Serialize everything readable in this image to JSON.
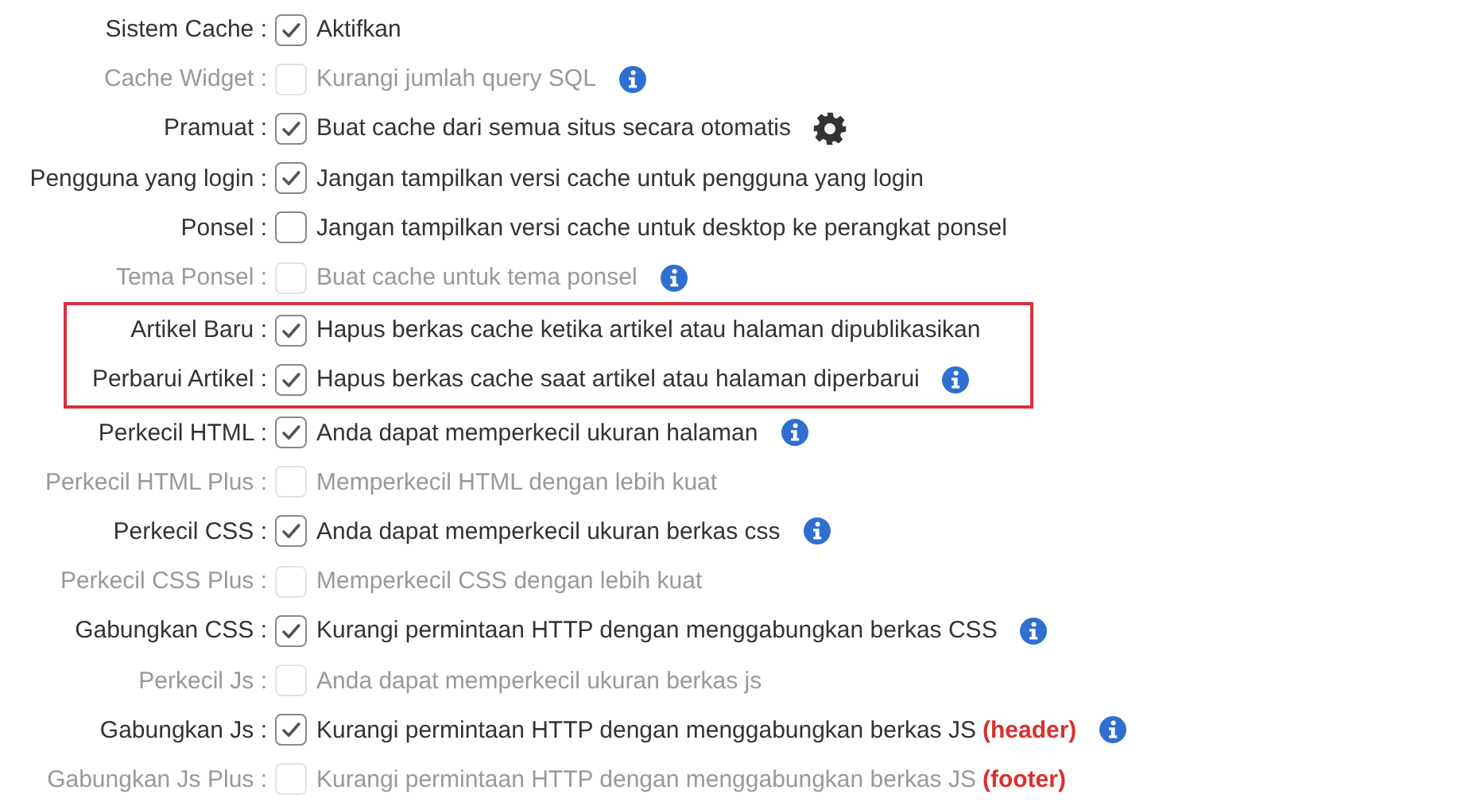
{
  "sections": [
    {
      "highlighted": false,
      "rows": [
        {
          "label": "Sistem Cache :",
          "checked": true,
          "disabled": false,
          "description": "Aktifkan"
        },
        {
          "label": "Cache Widget :",
          "checked": false,
          "disabled": true,
          "description": "Kurangi jumlah query SQL",
          "kind": "info"
        },
        {
          "label": "Pramuat :",
          "checked": true,
          "disabled": false,
          "description": "Buat cache dari semua situs secara otomatis",
          "kind": "gear"
        },
        {
          "label": "Pengguna yang login :",
          "checked": true,
          "disabled": false,
          "description": "Jangan tampilkan versi cache untuk pengguna yang login"
        },
        {
          "label": "Ponsel :",
          "checked": false,
          "disabled": false,
          "description": "Jangan tampilkan versi cache untuk desktop ke perangkat ponsel"
        },
        {
          "label": "Tema Ponsel :",
          "checked": false,
          "disabled": true,
          "description": "Buat cache untuk tema ponsel",
          "kind": "info"
        }
      ]
    },
    {
      "highlighted": true,
      "rows": [
        {
          "label": "Artikel Baru :",
          "checked": true,
          "disabled": false,
          "description": "Hapus berkas cache ketika artikel atau halaman dipublikasikan"
        },
        {
          "label": "Perbarui Artikel :",
          "checked": true,
          "disabled": false,
          "description": "Hapus berkas cache saat artikel atau halaman diperbarui",
          "kind": "info"
        }
      ]
    },
    {
      "highlighted": false,
      "rows": [
        {
          "label": "Perkecil HTML :",
          "checked": true,
          "disabled": false,
          "description": "Anda dapat memperkecil ukuran halaman",
          "kind": "info"
        },
        {
          "label": "Perkecil HTML Plus :",
          "checked": false,
          "disabled": true,
          "description": "Memperkecil HTML dengan lebih kuat"
        },
        {
          "label": "Perkecil CSS :",
          "checked": true,
          "disabled": false,
          "description": "Anda dapat memperkecil ukuran berkas css",
          "kind": "info"
        },
        {
          "label": "Perkecil CSS Plus :",
          "checked": false,
          "disabled": true,
          "description": "Memperkecil CSS dengan lebih kuat"
        },
        {
          "label": "Gabungkan CSS :",
          "checked": true,
          "disabled": false,
          "description": "Kurangi permintaan HTTP dengan menggabungkan berkas CSS",
          "kind": "info"
        },
        {
          "label": "Perkecil Js :",
          "checked": false,
          "disabled": true,
          "description": "Anda dapat memperkecil ukuran berkas js"
        },
        {
          "label": "Gabungkan Js :",
          "checked": true,
          "disabled": false,
          "description": "Kurangi permintaan HTTP dengan menggabungkan berkas JS",
          "note": "(header)",
          "kind": "info"
        },
        {
          "label": "Gabungkan Js Plus :",
          "checked": false,
          "disabled": true,
          "description": "Kurangi permintaan HTTP dengan menggabungkan berkas JS",
          "note": "(footer)"
        }
      ]
    }
  ]
}
